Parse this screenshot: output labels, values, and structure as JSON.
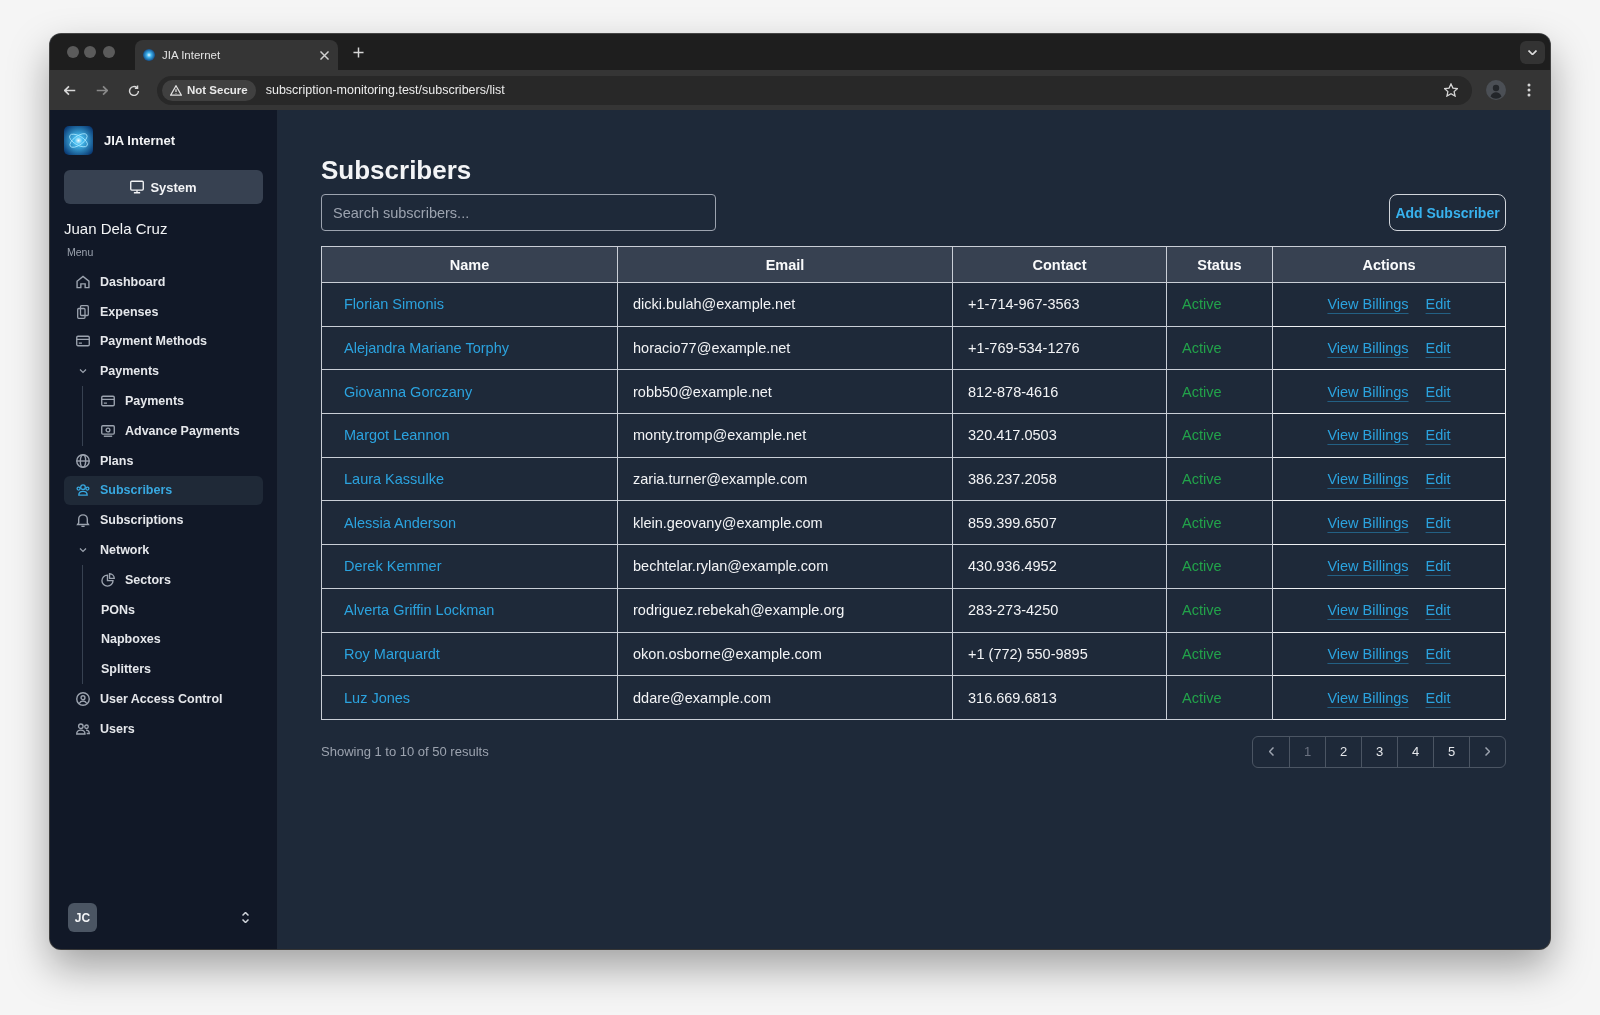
{
  "browser": {
    "tabs": [
      {
        "title": "JIA Internet",
        "selected": true
      }
    ],
    "address_bar": {
      "security_label": "Not Secure",
      "url": "subscription-monitoring.test/subscribers/list"
    }
  },
  "sidebar": {
    "brand": "JIA Internet",
    "system_button": "System",
    "user_name": "Juan Dela Cruz",
    "menu_label": "Menu",
    "items": [
      {
        "kind": "link",
        "label": "Dashboard",
        "selected": false
      },
      {
        "kind": "link",
        "label": "Expenses",
        "selected": false
      },
      {
        "kind": "link",
        "label": "Payment Methods",
        "selected": false
      },
      {
        "kind": "group",
        "label": "Payments",
        "selected": false,
        "expanded": true,
        "children": [
          {
            "label": "Payments",
            "selected": false
          },
          {
            "label": "Advance Payments",
            "selected": false
          }
        ]
      },
      {
        "kind": "link",
        "label": "Plans",
        "selected": false
      },
      {
        "kind": "link",
        "label": "Subscribers",
        "selected": true
      },
      {
        "kind": "link",
        "label": "Subscriptions",
        "selected": false
      },
      {
        "kind": "group",
        "label": "Network",
        "selected": false,
        "expanded": true,
        "children": [
          {
            "label": "Sectors",
            "selected": false
          },
          {
            "label": "PONs",
            "selected": false
          },
          {
            "label": "Napboxes",
            "selected": false
          },
          {
            "label": "Splitters",
            "selected": false
          }
        ]
      },
      {
        "kind": "link",
        "label": "User Access Control",
        "selected": false
      },
      {
        "kind": "link",
        "label": "Users",
        "selected": false
      }
    ],
    "account": {
      "initials": "JC"
    }
  },
  "page": {
    "title": "Subscribers",
    "search": {
      "placeholder": "Search subscribers..."
    },
    "add_button": "Add Subscriber"
  },
  "table": {
    "columns": [
      "Name",
      "Email",
      "Contact",
      "Status",
      "Actions"
    ],
    "rows": [
      {
        "name": "Florian Simonis",
        "email": "dicki.bulah@example.net",
        "contact": "+1-714-967-3563",
        "status": "Active",
        "actions": [
          "View Billings",
          "Edit"
        ]
      },
      {
        "name": "Alejandra Mariane Torphy",
        "email": "horacio77@example.net",
        "contact": "+1-769-534-1276",
        "status": "Active",
        "actions": [
          "View Billings",
          "Edit"
        ]
      },
      {
        "name": "Giovanna Gorczany",
        "email": "robb50@example.net",
        "contact": "812-878-4616",
        "status": "Active",
        "actions": [
          "View Billings",
          "Edit"
        ]
      },
      {
        "name": "Margot Leannon",
        "email": "monty.tromp@example.net",
        "contact": "320.417.0503",
        "status": "Active",
        "actions": [
          "View Billings",
          "Edit"
        ]
      },
      {
        "name": "Laura Kassulke",
        "email": "zaria.turner@example.com",
        "contact": "386.237.2058",
        "status": "Active",
        "actions": [
          "View Billings",
          "Edit"
        ]
      },
      {
        "name": "Alessia Anderson",
        "email": "klein.geovany@example.com",
        "contact": "859.399.6507",
        "status": "Active",
        "actions": [
          "View Billings",
          "Edit"
        ]
      },
      {
        "name": "Derek Kemmer",
        "email": "bechtelar.rylan@example.com",
        "contact": "430.936.4952",
        "status": "Active",
        "actions": [
          "View Billings",
          "Edit"
        ]
      },
      {
        "name": "Alverta Griffin Lockman",
        "email": "rodriguez.rebekah@example.org",
        "contact": "283-273-4250",
        "status": "Active",
        "actions": [
          "View Billings",
          "Edit"
        ]
      },
      {
        "name": "Roy Marquardt",
        "email": "okon.osborne@example.com",
        "contact": "+1 (772) 550-9895",
        "status": "Active",
        "actions": [
          "View Billings",
          "Edit"
        ]
      },
      {
        "name": "Luz Jones",
        "email": "ddare@example.com",
        "contact": "316.669.6813",
        "status": "Active",
        "actions": [
          "View Billings",
          "Edit"
        ]
      }
    ]
  },
  "pagination": {
    "summary": "Showing 1 to 10 of 50 results",
    "pages": [
      {
        "label": "1",
        "selected": true
      },
      {
        "label": "2",
        "selected": false
      },
      {
        "label": "3",
        "selected": false
      },
      {
        "label": "4",
        "selected": false
      },
      {
        "label": "5",
        "selected": false
      }
    ]
  }
}
